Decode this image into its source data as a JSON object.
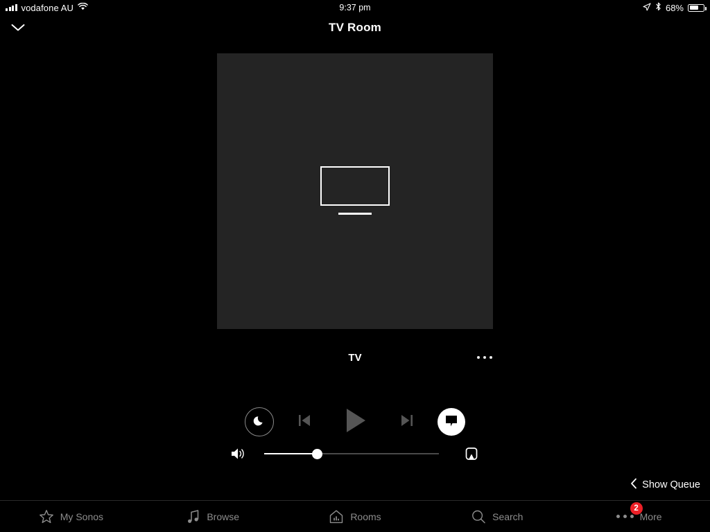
{
  "status_bar": {
    "carrier": "vodafone AU",
    "time": "9:37 pm",
    "battery_percent": "68%",
    "signal_icon": "cellular-bars-icon",
    "wifi_icon": "wifi-icon",
    "location_icon": "location-arrow-icon",
    "bluetooth_icon": "bluetooth-icon",
    "battery_icon": "battery-icon"
  },
  "header": {
    "title": "TV Room",
    "collapse_icon": "chevron-down-icon"
  },
  "now_playing": {
    "artwork_icon": "tv-icon",
    "artwork_bg": "#242424",
    "source_name": "TV",
    "more_icon": "ellipsis-icon"
  },
  "transport": {
    "sleep_timer_icon": "moon-icon",
    "previous_icon": "skip-previous-icon",
    "play_icon": "play-icon",
    "next_icon": "skip-next-icon",
    "speech_enhancement_icon": "speech-bubble-icon",
    "disabled_color": "#555555",
    "active_color": "#ffffff"
  },
  "volume": {
    "speaker_icon": "speaker-wave-icon",
    "level_percent": 30,
    "group_icon": "speaker-group-icon"
  },
  "queue": {
    "label": "Show Queue",
    "chevron_icon": "chevron-left-icon"
  },
  "tabbar": {
    "accent_badge_color": "#ec2027",
    "items": [
      {
        "label": "My Sonos",
        "icon": "star-icon"
      },
      {
        "label": "Browse",
        "icon": "music-note-icon"
      },
      {
        "label": "Rooms",
        "icon": "house-bars-icon"
      },
      {
        "label": "Search",
        "icon": "magnifier-icon"
      },
      {
        "label": "More",
        "icon": "ellipsis-icon",
        "badge": "2"
      }
    ]
  }
}
